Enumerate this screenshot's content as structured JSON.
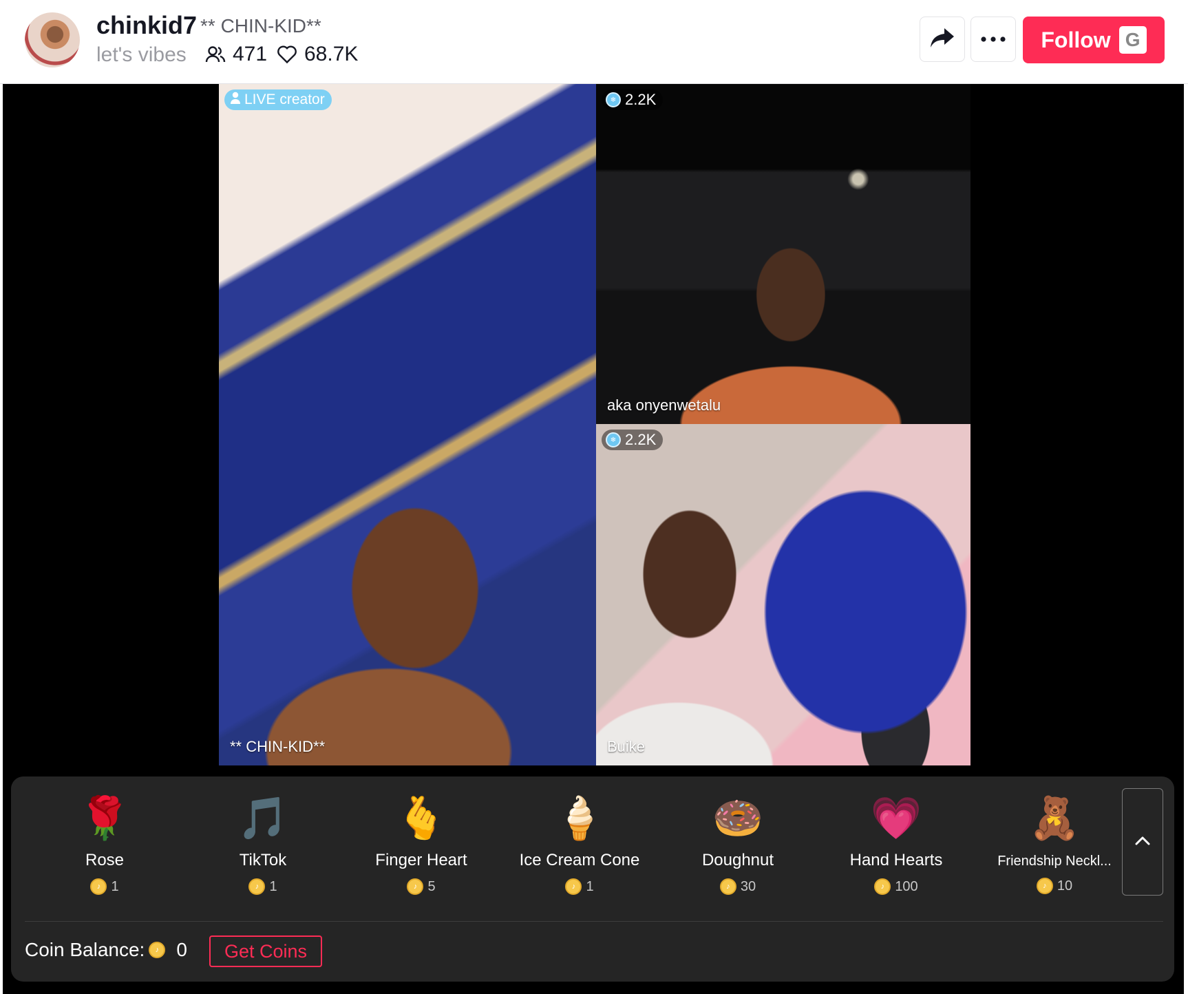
{
  "header": {
    "username": "chinkid7",
    "nickname": "** CHIN-KID**",
    "bio": "let's vibes",
    "viewers": "471",
    "likes": "68.7K",
    "follow_label": "Follow",
    "follow_shortcut": "G"
  },
  "stage": {
    "main": {
      "badge": "LIVE creator",
      "name": "** CHIN-KID**"
    },
    "guests": [
      {
        "badge": "2.2K",
        "name": "aka onyenwetalu"
      },
      {
        "badge": "2.2K",
        "name": "Buike"
      }
    ]
  },
  "gifts": [
    {
      "name": "Rose",
      "price": "1",
      "icon": "🌹"
    },
    {
      "name": "TikTok",
      "price": "1",
      "icon": "🎵"
    },
    {
      "name": "Finger Heart",
      "price": "5",
      "icon": "🫰"
    },
    {
      "name": "Ice Cream Cone",
      "price": "1",
      "icon": "🍦"
    },
    {
      "name": "Doughnut",
      "price": "30",
      "icon": "🍩"
    },
    {
      "name": "Hand Hearts",
      "price": "100",
      "icon": "💗"
    },
    {
      "name": "Friendship Neckl...",
      "price": "10",
      "icon": "🧸"
    }
  ],
  "wallet": {
    "balance_label": "Coin Balance:",
    "balance": "0",
    "get_coins_label": "Get Coins"
  },
  "colors": {
    "accent": "#fe2c55",
    "panel": "#252525",
    "live_badge": "#7ed0f4",
    "coin": "#f7c84b"
  }
}
